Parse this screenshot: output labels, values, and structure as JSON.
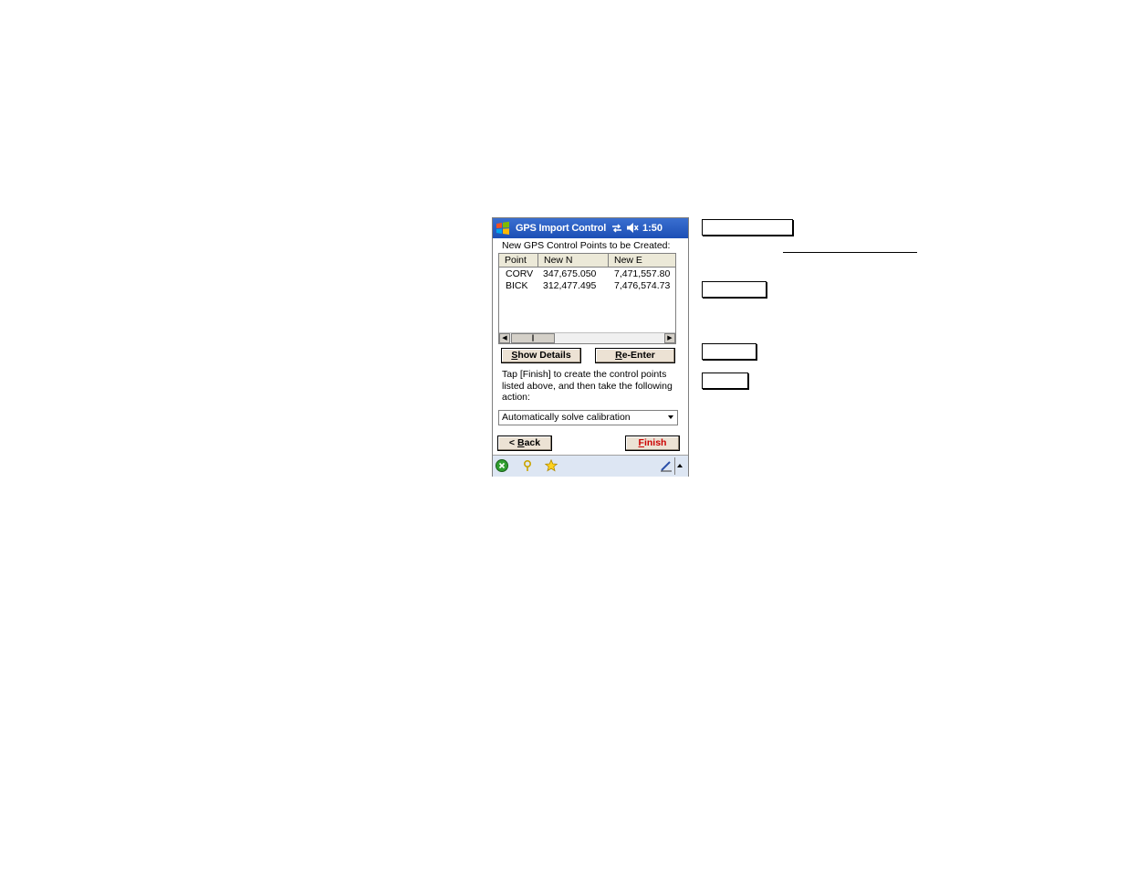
{
  "titlebar": {
    "start_icon": "windows-flag-icon",
    "title": "GPS Import Control",
    "connectivity_icon": "connectivity-arrows-icon",
    "volume_icon": "speaker-muted-icon",
    "time": "1:50"
  },
  "heading": "New GPS Control Points to be Created:",
  "table": {
    "columns": [
      "Point",
      "New N",
      "New E"
    ],
    "rows": [
      {
        "point": "CORV",
        "new_n": "347,675.050",
        "new_e": "7,471,557.80"
      },
      {
        "point": "BICK",
        "new_n": "312,477.495",
        "new_e": "7,476,574.73"
      }
    ],
    "horizontal_scroll_fraction": 0.0
  },
  "buttons": {
    "show_details": {
      "pre": "",
      "underlined": "S",
      "post": "how Details"
    },
    "re_enter": {
      "pre": "",
      "underlined": "R",
      "post": "e-Enter"
    },
    "back": {
      "pre": "< ",
      "underlined": "B",
      "post": "ack"
    },
    "finish": {
      "pre": "",
      "underlined": "F",
      "post": "inish"
    }
  },
  "instructions": "Tap [Finish] to create the control points listed above, and then take the following action:",
  "action_select": {
    "selected": "Automatically solve calibration"
  },
  "taskbar": {
    "icons": [
      "close-circle-icon",
      "help-icon",
      "favorites-star-icon",
      "pen-input-icon",
      "sip-up-arrow-icon"
    ]
  },
  "colors": {
    "titlebar": "#1c4fb5",
    "button_face": "#ece2d4",
    "finish_text": "#cc0000",
    "taskbar": "#dde6f3"
  }
}
